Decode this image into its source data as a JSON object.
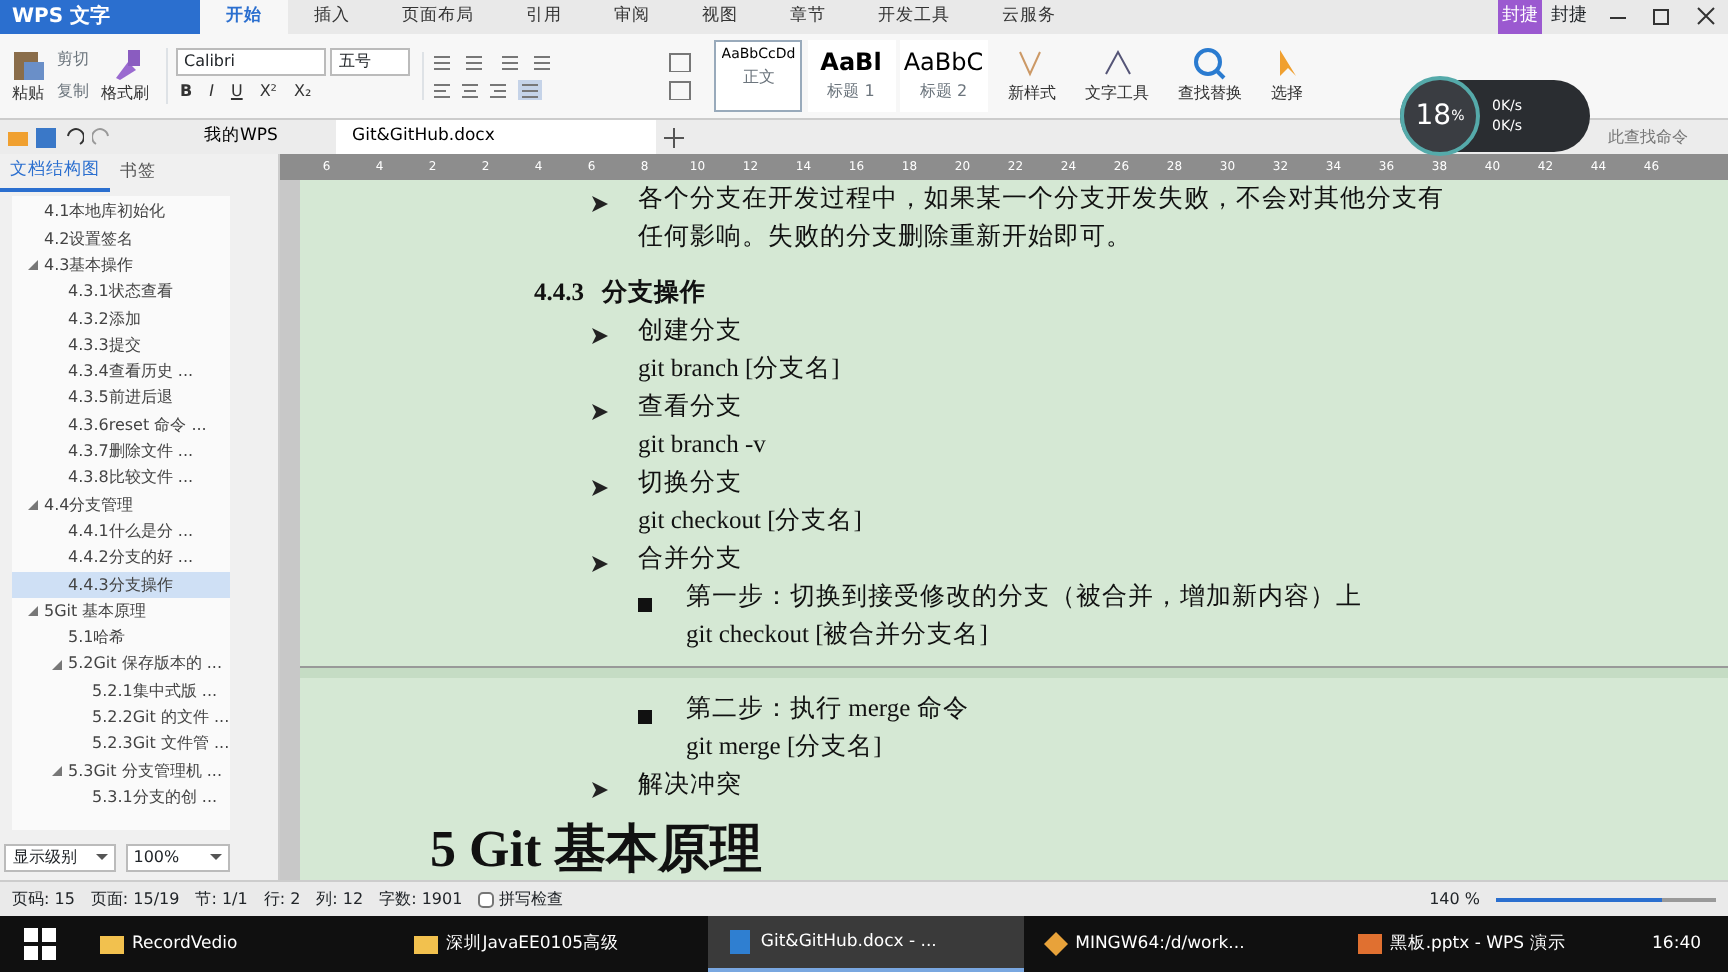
{
  "app_menu": {
    "title": "WPS 文字"
  },
  "ribbon_tabs": [
    {
      "label": "开始",
      "selected": true
    },
    {
      "label": "插入",
      "selected": false
    },
    {
      "label": "页面布局",
      "selected": false
    },
    {
      "label": "引用",
      "selected": false
    },
    {
      "label": "审阅",
      "selected": false
    },
    {
      "label": "视图",
      "selected": false
    },
    {
      "label": "章节",
      "selected": false
    },
    {
      "label": "开发工具",
      "selected": false
    },
    {
      "label": "云服务",
      "selected": false
    }
  ],
  "account": {
    "badge": "封捷",
    "name": "封捷"
  },
  "clipboard": {
    "paste": "粘贴",
    "cut": "剪切",
    "copy": "复制",
    "format_painter": "格式刷"
  },
  "font": {
    "name": "Calibri",
    "size": "五号",
    "bold": "B",
    "italic": "I",
    "underline": "U",
    "superscript": "X²",
    "subscript": "X₂"
  },
  "styles": [
    {
      "preview": "AaBbCcDd",
      "label": "正文",
      "selected": true
    },
    {
      "preview": "AaBl",
      "label": "标题 1",
      "selected": false
    },
    {
      "preview": "AaBbC",
      "label": "标题 2",
      "selected": false
    }
  ],
  "ribbon_buttons": [
    {
      "label": "新样式"
    },
    {
      "label": "文字工具"
    },
    {
      "label": "查找替换"
    },
    {
      "label": "选择"
    }
  ],
  "command_search": {
    "placeholder": "此查找命令"
  },
  "speed_widget": {
    "percent": "18",
    "unit": "%",
    "upload": "0K/s",
    "download": "0K/s"
  },
  "doc_tabs": [
    {
      "label": "我的WPS",
      "selected": false
    },
    {
      "label": "Git&GitHub.docx",
      "selected": true
    }
  ],
  "ruler": {
    "labels": [
      "6",
      "4",
      "2",
      "2",
      "4",
      "6",
      "8",
      "10",
      "12",
      "14",
      "16",
      "18",
      "20",
      "22",
      "24",
      "26",
      "28",
      "30",
      "32",
      "34",
      "36",
      "38",
      "40",
      "42",
      "44",
      "46"
    ]
  },
  "nav_panel": {
    "tabs": [
      {
        "label": "文档结构图",
        "selected": true
      },
      {
        "label": "书签",
        "selected": false
      }
    ],
    "tree": [
      {
        "label": "4.1本地库初始化",
        "selected": false
      },
      {
        "label": "4.2设置签名",
        "selected": false
      },
      {
        "label": "4.3基本操作",
        "selected": false,
        "expanded": true,
        "children": [
          {
            "label": "4.3.1状态查看",
            "selected": false
          },
          {
            "label": "4.3.2添加",
            "selected": false
          },
          {
            "label": "4.3.3提交",
            "selected": false
          },
          {
            "label": "4.3.4查看历史 ...",
            "selected": false
          },
          {
            "label": "4.3.5前进后退",
            "selected": false
          },
          {
            "label": "4.3.6reset 命令 ...",
            "selected": false
          },
          {
            "label": "4.3.7删除文件 ...",
            "selected": false
          },
          {
            "label": "4.3.8比较文件 ...",
            "selected": false
          }
        ]
      },
      {
        "label": "4.4分支管理",
        "selected": false,
        "expanded": true,
        "children": [
          {
            "label": "4.4.1什么是分 ...",
            "selected": false
          },
          {
            "label": "4.4.2分支的好 ...",
            "selected": false
          },
          {
            "label": "4.4.3分支操作",
            "selected": true
          }
        ]
      },
      {
        "label": "5Git 基本原理",
        "selected": false,
        "expanded": true,
        "children": [
          {
            "label": "5.1哈希",
            "selected": false
          },
          {
            "label": "5.2Git 保存版本的 ...",
            "selected": false,
            "expanded": true,
            "children": [
              {
                "label": "5.2.1集中式版 ...",
                "selected": false
              },
              {
                "label": "5.2.2Git 的文件 ...",
                "selected": false
              },
              {
                "label": "5.2.3Git 文件管 ...",
                "selected": false
              }
            ]
          },
          {
            "label": "5.3Git 分支管理机 ...",
            "selected": false,
            "expanded": true,
            "children": [
              {
                "label": "5.3.1分支的创 ...",
                "selected": false
              }
            ]
          }
        ]
      }
    ],
    "level_select": "显示级别",
    "zoom_select": "100%"
  },
  "document": [
    {
      "kind": "bullet",
      "text": "各个分支在开发过程中，如果某一个分支开发失败，不会对其他分支有任何影响。失败的分支删除重新开始即可。"
    },
    {
      "kind": "heading",
      "number": "4.4.3",
      "text": "分支操作"
    },
    {
      "kind": "bullet",
      "text": "创建分支"
    },
    {
      "kind": "command",
      "text": "git branch [分支名]"
    },
    {
      "kind": "bullet",
      "text": "查看分支"
    },
    {
      "kind": "command",
      "text": "git branch -v"
    },
    {
      "kind": "bullet",
      "text": "切换分支"
    },
    {
      "kind": "command",
      "text": "git checkout [分支名]"
    },
    {
      "kind": "bullet",
      "text": "合并分支"
    },
    {
      "kind": "square",
      "text": "第一步：切换到接受修改的分支（被合并，增加新内容）上"
    },
    {
      "kind": "subcommand",
      "text": "git checkout [被合并分支名]"
    },
    {
      "kind": "pagebreak"
    },
    {
      "kind": "square",
      "text": "第二步：执行 merge 命令"
    },
    {
      "kind": "subcommand",
      "text": "git merge [分支名]"
    },
    {
      "kind": "bullet",
      "text": "解决冲突"
    },
    {
      "kind": "title",
      "text": "5 Git 基本原理"
    }
  ],
  "status_bar": {
    "fields": [
      "页码: 15",
      "页面: 15/19",
      "节: 1/1",
      "行: 2",
      "列: 12",
      "字数: 1901"
    ],
    "spell_check": {
      "label": "拼写检查",
      "checked": false
    },
    "zoom": "140 %",
    "zoom_level": {
      "level": 0.75
    }
  },
  "taskbar": {
    "items": [
      {
        "label": "RecordVedio",
        "selected": false,
        "kind": "folder"
      },
      {
        "label": "深圳JavaEE0105高级",
        "selected": false,
        "kind": "folder"
      },
      {
        "label": "Git&GitHub.docx - ...",
        "selected": true,
        "kind": "writer"
      },
      {
        "label": "MINGW64:/d/work...",
        "selected": false,
        "kind": "git"
      },
      {
        "label": "黑板.pptx - WPS 演示",
        "selected": false,
        "kind": "slides"
      }
    ],
    "clock": "16:40"
  }
}
